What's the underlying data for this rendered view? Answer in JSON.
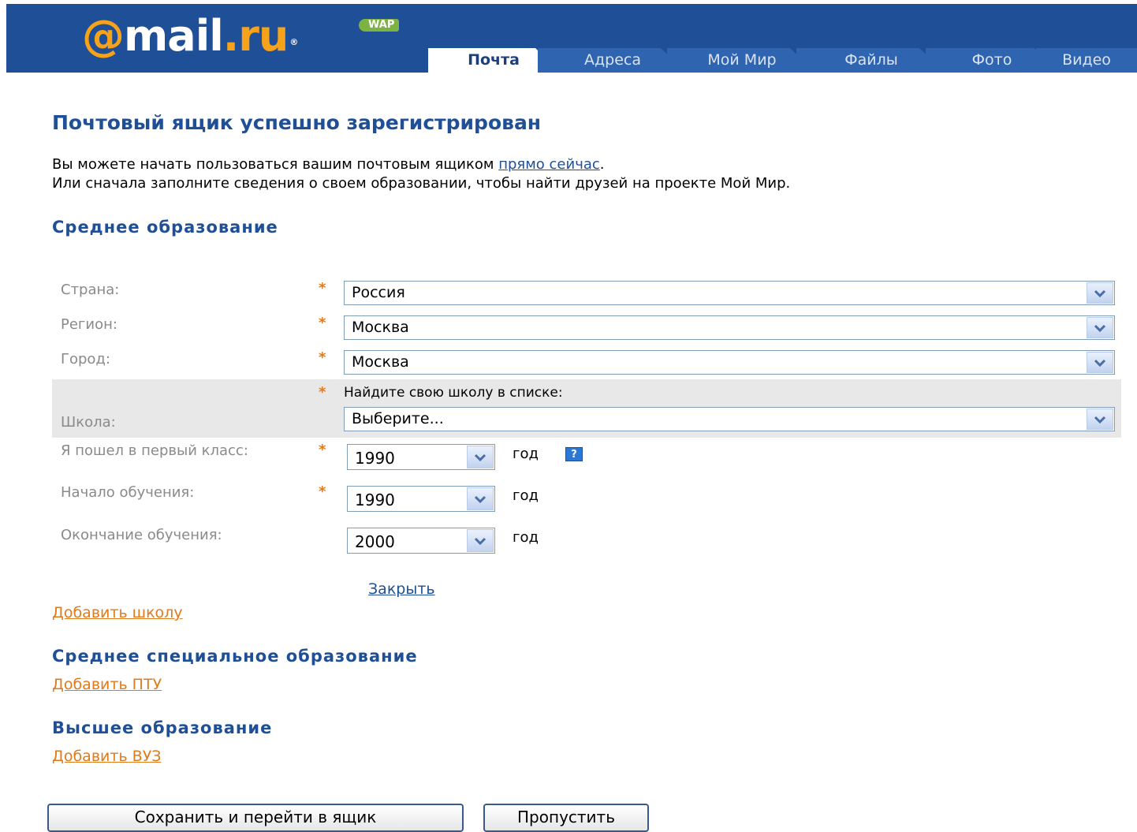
{
  "header": {
    "logo": {
      "at": "@",
      "mail": "mail",
      "dot": ".",
      "ru": "ru",
      "reg": "®"
    },
    "wap_badge": "WAP",
    "tabs": [
      {
        "label": "Почта",
        "active": true
      },
      {
        "label": "Адреса",
        "active": false
      },
      {
        "label": "Мой Мир",
        "active": false
      },
      {
        "label": "Файлы",
        "active": false
      },
      {
        "label": "Фото",
        "active": false
      },
      {
        "label": "Видео",
        "active": false
      }
    ],
    "bg_color": "#1f4f96"
  },
  "main": {
    "title": "Почтовый ящик успешно зарегистрирован",
    "intro_line1_prefix": "Вы можете начать пользоваться вашим почтовым ящиком ",
    "intro_link": "прямо сейчас",
    "intro_line1_suffix": ".",
    "intro_line2": "Или сначала заполните сведения о своем образовании, чтобы найти друзей на проекте Мой Мир."
  },
  "secondary_education": {
    "heading": "Среднее образование",
    "country": {
      "label": "Страна:",
      "value": "Россия"
    },
    "region": {
      "label": "Регион:",
      "value": "Москва"
    },
    "city": {
      "label": "Город:",
      "value": "Москва"
    },
    "school": {
      "label": "Школа:",
      "hint": "Найдите свою школу в списке:",
      "value": "Выберите..."
    },
    "first_grade": {
      "label": "Я пошел в первый класс:",
      "value": "1990",
      "unit": "год"
    },
    "start": {
      "label": "Начало обучения:",
      "value": "1990",
      "unit": "год"
    },
    "end": {
      "label": "Окончание обучения:",
      "value": "2000",
      "unit": "год"
    },
    "required_mark": "*",
    "help_icon": "?",
    "close_link": "Закрыть",
    "add_school_link": "Добавить школу"
  },
  "vocational_education": {
    "heading": "Среднее специальное образование",
    "add_link": "Добавить ПТУ"
  },
  "higher_education": {
    "heading": "Высшее образование",
    "add_link": "Добавить ВУЗ"
  },
  "buttons": {
    "save": "Сохранить и перейти в ящик",
    "skip": "Пропустить"
  },
  "colors": {
    "accent_blue": "#1f4f96",
    "accent_orange": "#e07a1a"
  }
}
